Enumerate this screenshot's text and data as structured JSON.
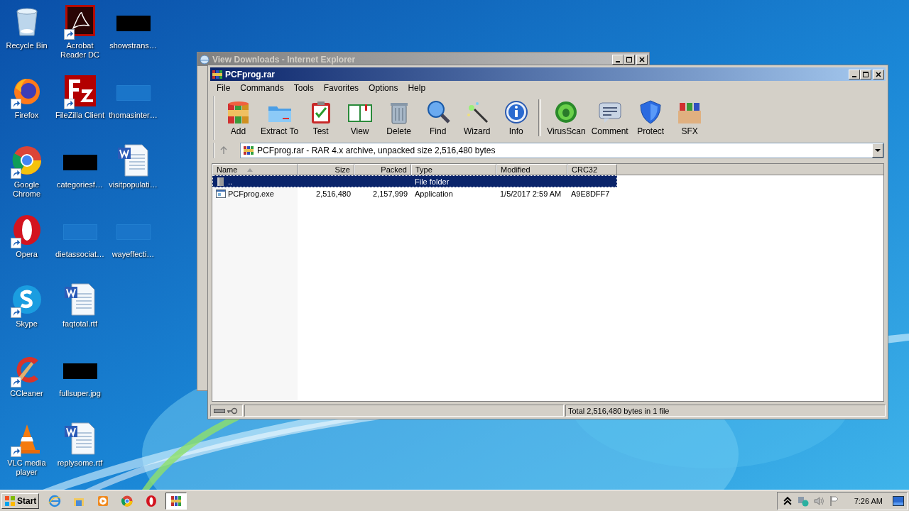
{
  "desktop": {
    "icons": [
      {
        "label": "Recycle Bin",
        "kind": "recycle",
        "shortcut": false
      },
      {
        "label": "Firefox",
        "kind": "firefox",
        "shortcut": true
      },
      {
        "label": "Google Chrome",
        "kind": "chrome",
        "shortcut": true
      },
      {
        "label": "Opera",
        "kind": "opera",
        "shortcut": true
      },
      {
        "label": "Skype",
        "kind": "skype",
        "shortcut": true
      },
      {
        "label": "CCleaner",
        "kind": "ccleaner",
        "shortcut": true
      },
      {
        "label": "VLC media player",
        "kind": "vlc",
        "shortcut": true
      },
      {
        "label": "Acrobat Reader DC",
        "kind": "acrobat",
        "shortcut": true
      },
      {
        "label": "FileZilla Client",
        "kind": "filezilla",
        "shortcut": true
      },
      {
        "label": "categoriesf…",
        "kind": "thumbnail",
        "shortcut": false
      },
      {
        "label": "dietassociat…",
        "kind": "blank",
        "shortcut": false
      },
      {
        "label": "faqtotal.rtf",
        "kind": "document",
        "shortcut": false
      },
      {
        "label": "fullsuper.jpg",
        "kind": "thumbnail",
        "shortcut": false
      },
      {
        "label": "replysome.rtf",
        "kind": "document",
        "shortcut": false
      },
      {
        "label": "showstrans…",
        "kind": "thumbnail",
        "shortcut": false
      },
      {
        "label": "thomasinter…",
        "kind": "blank",
        "shortcut": false
      },
      {
        "label": "visitpopulati…",
        "kind": "document",
        "shortcut": false
      },
      {
        "label": "wayeffecti…",
        "kind": "blank",
        "shortcut": false
      }
    ]
  },
  "background_window": {
    "title": "View Downloads - Internet Explorer",
    "active": false
  },
  "window": {
    "title": "PCFprog.rar",
    "active": true,
    "menu": [
      "File",
      "Commands",
      "Tools",
      "Favorites",
      "Options",
      "Help"
    ],
    "toolbar": [
      {
        "label": "Add",
        "kind": "add"
      },
      {
        "label": "Extract To",
        "kind": "extract"
      },
      {
        "label": "Test",
        "kind": "test"
      },
      {
        "label": "View",
        "kind": "view"
      },
      {
        "label": "Delete",
        "kind": "delete"
      },
      {
        "label": "Find",
        "kind": "find"
      },
      {
        "label": "Wizard",
        "kind": "wizard"
      },
      {
        "label": "Info",
        "kind": "info"
      },
      {
        "label": "VirusScan",
        "kind": "virusscan"
      },
      {
        "label": "Comment",
        "kind": "comment"
      },
      {
        "label": "Protect",
        "kind": "protect"
      },
      {
        "label": "SFX",
        "kind": "sfx"
      }
    ],
    "address": "PCFprog.rar - RAR 4.x archive, unpacked size 2,516,480 bytes",
    "columns": [
      {
        "label": "Name",
        "sorted": true
      },
      {
        "label": "Size",
        "sorted": false
      },
      {
        "label": "Packed",
        "sorted": false
      },
      {
        "label": "Type",
        "sorted": false
      },
      {
        "label": "Modified",
        "sorted": false
      },
      {
        "label": "CRC32",
        "sorted": false
      }
    ],
    "rows": [
      {
        "name": "..",
        "type": "File folder",
        "kind": "folder",
        "selected": true
      },
      {
        "name": "PCFprog.exe",
        "size": "2,516,480",
        "packed": "2,157,999",
        "type": "Application",
        "modified": "1/5/2017 2:59 AM",
        "crc32": "A9E8DFF7",
        "kind": "exe",
        "selected": false
      }
    ],
    "status": "Total 2,516,480 bytes in 1 file"
  },
  "taskbar": {
    "start": "Start",
    "apps": [
      {
        "kind": "ie",
        "selected": false
      },
      {
        "kind": "explorer",
        "selected": false
      },
      {
        "kind": "media",
        "selected": false
      },
      {
        "kind": "chrome",
        "selected": false
      },
      {
        "kind": "opera",
        "selected": false
      },
      {
        "kind": "winrar",
        "selected": true
      }
    ],
    "clock": "7:26 AM"
  }
}
